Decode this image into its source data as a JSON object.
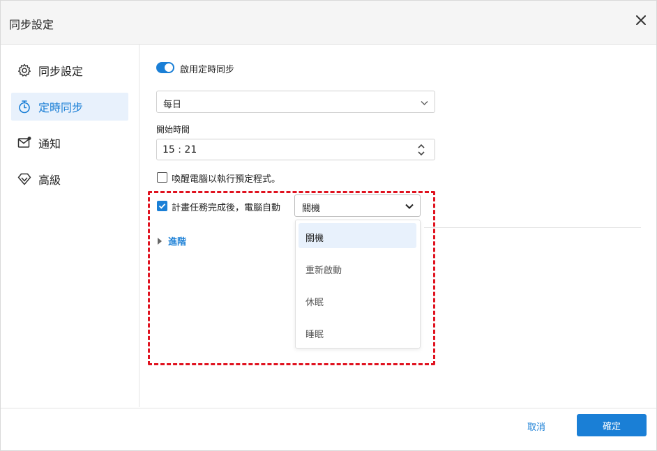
{
  "dialog": {
    "title": "同步設定",
    "close_icon": "close-icon"
  },
  "sidebar": {
    "items": [
      {
        "label": "同步設定",
        "icon": "gear-icon",
        "active": false
      },
      {
        "label": "定時同步",
        "icon": "timer-icon",
        "active": true
      },
      {
        "label": "通知",
        "icon": "mail-notification-icon",
        "active": false
      },
      {
        "label": "高級",
        "icon": "diamond-icon",
        "active": false
      }
    ]
  },
  "schedule": {
    "enable_label": "啟用定時同步",
    "enabled": true,
    "frequency_value": "每日",
    "start_time_label": "開始時間",
    "start_time_value": "15 : 21",
    "wake_label": "喚醒電腦以執行預定程式。",
    "wake_checked": false,
    "after_task_label": "計畫任務完成後，電腦自動",
    "after_task_checked": true,
    "action_value": "關機",
    "action_options": [
      "關機",
      "重新啟動",
      "休眠",
      "睡眠"
    ],
    "advanced_label": "進階"
  },
  "footer": {
    "cancel_label": "取消",
    "ok_label": "確定"
  },
  "colors": {
    "accent": "#1a7fd6",
    "highlight_border": "#e0121f",
    "active_bg": "#e8f1fc"
  }
}
